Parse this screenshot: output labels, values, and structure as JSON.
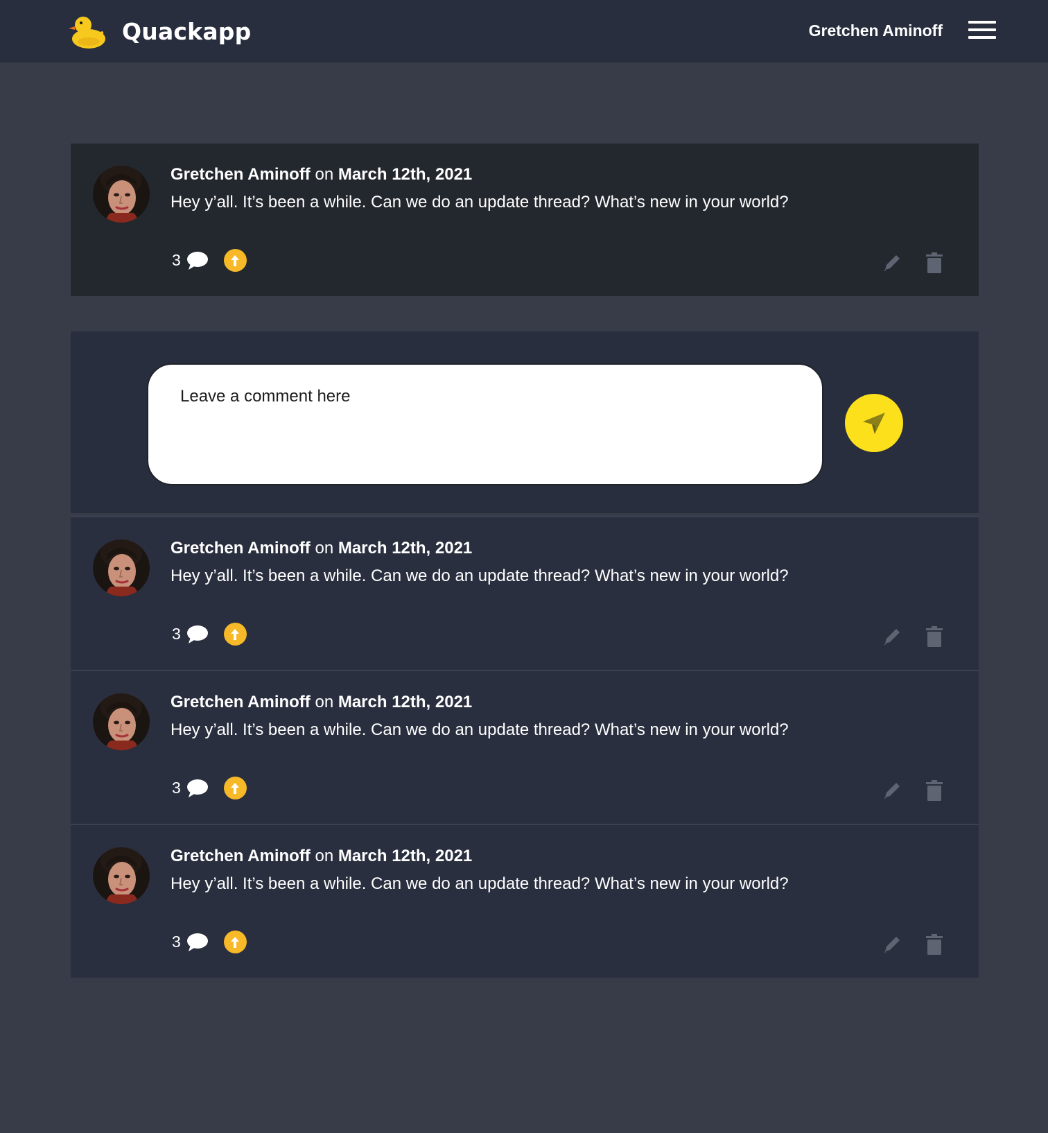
{
  "header": {
    "brand_name": "Quackapp",
    "logo_icon": "rubber-duck-icon",
    "user_name": "Gretchen Aminoff",
    "menu_icon": "hamburger-menu-icon"
  },
  "post": {
    "author": "Gretchen Aminoff",
    "on": "on",
    "date": "March 12th, 2021",
    "text": "Hey y’all. It’s been a while. Can we do an update thread? What’s new in your world?",
    "comment_count": "3"
  },
  "composer": {
    "placeholder": "Leave a comment here",
    "send_icon": "send-icon"
  },
  "comments": [
    {
      "author": "Gretchen Aminoff",
      "on": "on",
      "date": "March 12th, 2021",
      "text": "Hey y’all. It’s been a while. Can we do an update thread? What’s new in your world?",
      "comment_count": "3"
    },
    {
      "author": "Gretchen Aminoff",
      "on": "on",
      "date": "March 12th, 2021",
      "text": "Hey y’all. It’s been a while. Can we do an update thread? What’s new in your world?",
      "comment_count": "3"
    },
    {
      "author": "Gretchen Aminoff",
      "on": "on",
      "date": "March 12th, 2021",
      "text": "Hey y’all. It’s been a while. Can we do an update thread? What’s new in your world?",
      "comment_count": "3"
    }
  ],
  "colors": {
    "page_background": "#383c48",
    "header_background": "#282e3e",
    "post_background": "#23272e",
    "comment_background": "#2a2f3f",
    "upvote": "#f7b928",
    "send_button": "#fde01c",
    "action_icon": "#5f6472"
  }
}
